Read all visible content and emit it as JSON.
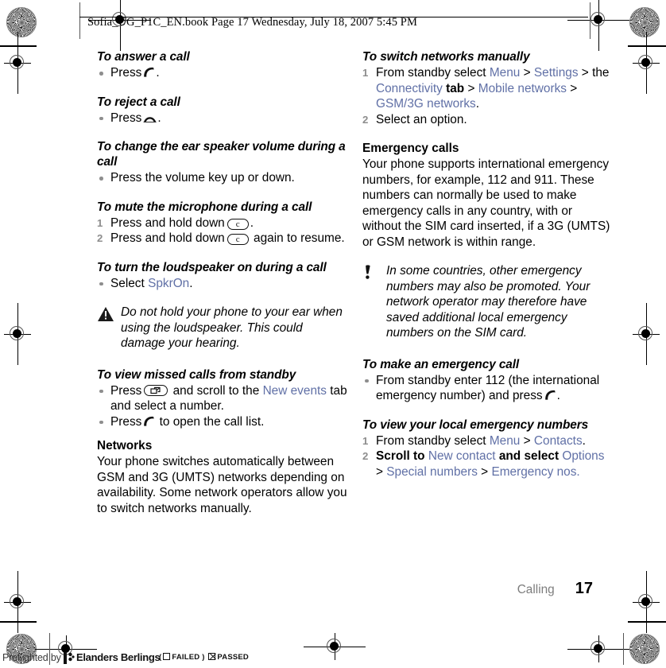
{
  "header": {
    "text": "Sofia_UG_P1C_EN.book  Page 17  Wednesday, July 18, 2007  5:45 PM"
  },
  "left_column": {
    "blocks": [
      {
        "heading": "To answer a call",
        "bullet_press": "Press",
        "bullet_tail": "."
      },
      {
        "heading": "To reject a call",
        "bullet_press": "Press",
        "bullet_tail": "."
      },
      {
        "heading": "To change the ear speaker volume during a call",
        "bullet": "Press the volume key up or down."
      },
      {
        "heading": "To mute the microphone during a call",
        "step1_a": "Press and hold down",
        "step1_b": ".",
        "step2_a": "Press and hold down",
        "step2_b": " again to resume.",
        "key_label": "c"
      },
      {
        "heading": "To turn the loudspeaker on during a call",
        "bullet_select": "Select",
        "bullet_link": "SpkrOn",
        "bullet_tail": "."
      },
      {
        "warning": "Do not hold your phone to your ear when using the loudspeaker. This could damage your hearing."
      },
      {
        "heading": "To view missed calls from standby",
        "b1_a": "Press",
        "b1_b": " and scroll to the ",
        "b1_link": "New events",
        "b1_c": " tab and select a number.",
        "b2_a": "Press",
        "b2_b": " to open the call list."
      },
      {
        "section": "Networks",
        "body": "Your phone switches automatically between GSM and 3G (UMTS) networks depending on availability. Some network operators allow you to switch networks manually."
      }
    ]
  },
  "right_column": {
    "blocks": [
      {
        "heading": "To switch networks manually",
        "step1_a": "From standby select ",
        "step1_link1": "Menu",
        "step1_sep1": " > ",
        "step1_link2": "Settings",
        "step1_sep2": " > the ",
        "step1_link3": "Connectivity",
        "step1_bold": " tab",
        "step1_sep3": " > ",
        "step1_link4": "Mobile networks",
        "step1_sep4": " > ",
        "step1_link5": "GSM/3G networks",
        "step1_end": ".",
        "step2": "Select an option."
      },
      {
        "section": "Emergency calls",
        "body": "Your phone supports international emergency numbers, for example, 112 and 911. These numbers can normally be used to make emergency calls in any country, with or without the SIM card inserted, if a 3G (UMTS) or GSM network is within range."
      },
      {
        "note": "In some countries, other emergency numbers may also be promoted. Your network operator may therefore have saved additional local emergency numbers on the SIM card."
      },
      {
        "heading": "To make an emergency call",
        "bullet_a": "From standby enter 112 (the international emergency number) and press",
        "bullet_b": "."
      },
      {
        "heading": "To view your local emergency numbers",
        "step1_a": "From standby select ",
        "step1_link1": "Menu",
        "step1_sep": " > ",
        "step1_link2": "Contacts",
        "step1_end": ".",
        "step2_bold1": "Scroll to ",
        "step2_link1": "New contact",
        "step2_bold2": " and select ",
        "step2_link2": "Options",
        "step2_sep": " > ",
        "step2_link3": "Special numbers",
        "step2_sep2": " > ",
        "step2_link4": "Emergency nos.",
        "step2_end": ""
      }
    ]
  },
  "footer": {
    "chapter": "Calling",
    "page_number": "17"
  },
  "preflight": {
    "label": "Preflighted by",
    "brand": "Elanders Berlings",
    "failed_open": "(",
    "failed_label": "FAILED",
    "failed_close": ")",
    "passed_label": "PASSED"
  },
  "colors": {
    "link": "#6070a6",
    "step_number": "#8d8d8d",
    "bullet": "#8e8e8e",
    "chapter": "#7d7d7d"
  }
}
